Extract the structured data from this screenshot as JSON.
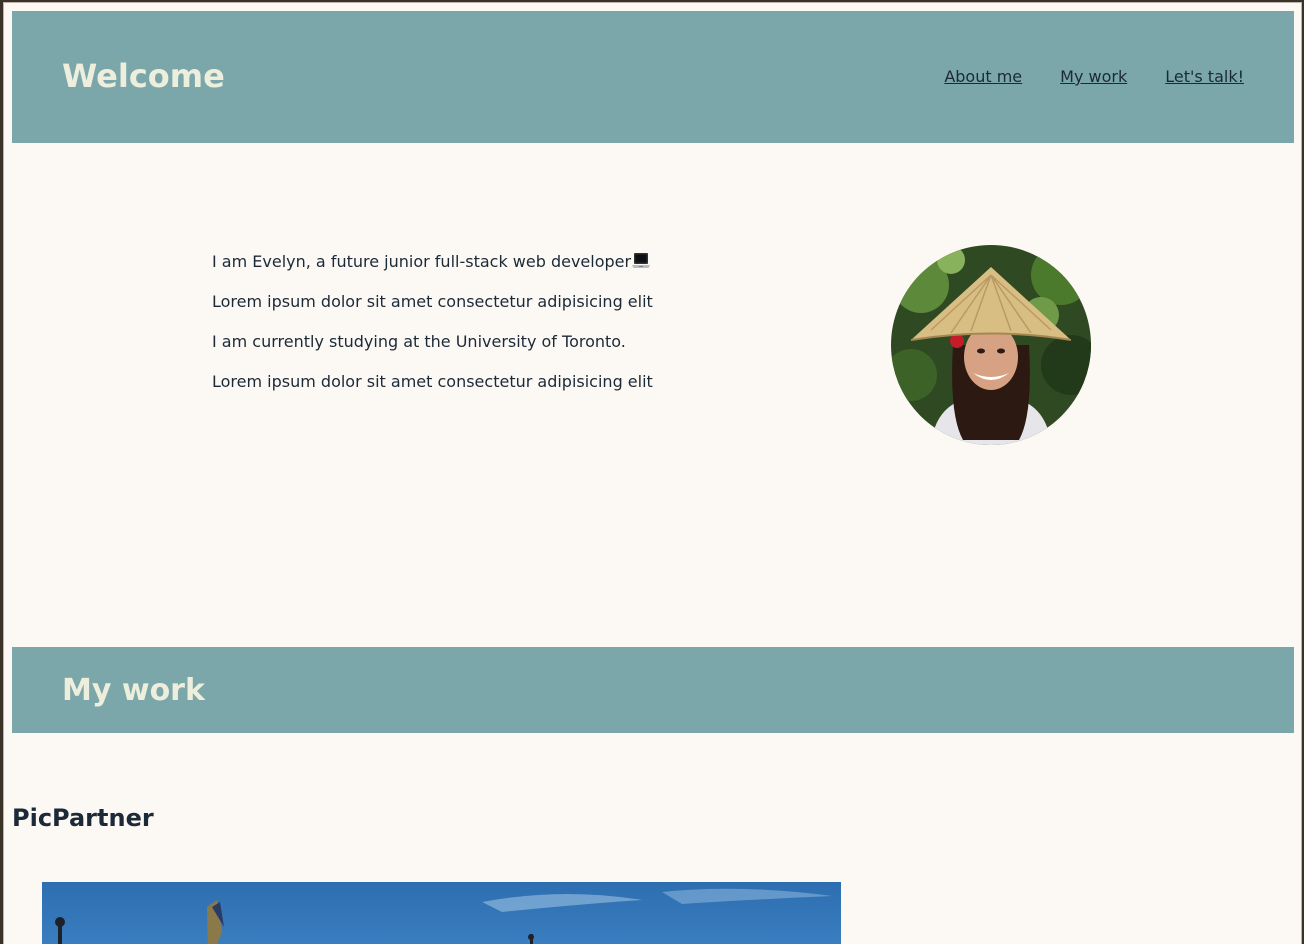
{
  "header": {
    "title": "Welcome",
    "nav": [
      "About me",
      "My work",
      "Let's talk!"
    ]
  },
  "intro": {
    "lines": [
      "I am Evelyn, a future junior full-stack web developer",
      "Lorem ipsum dolor sit amet consectetur adipisicing elit",
      "I am currently studying at the University of Toronto.",
      "Lorem ipsum dolor sit amet consectetur adipisicing elit"
    ],
    "emoji_icon": "laptop-icon"
  },
  "work": {
    "section_title": "My work",
    "projects": [
      {
        "title": "PicPartner"
      }
    ]
  },
  "colors": {
    "header_bg": "#7ba7ab",
    "page_bg": "#fcf8f4",
    "heading_text": "#eeeedc",
    "body_text": "#1c2a38"
  }
}
